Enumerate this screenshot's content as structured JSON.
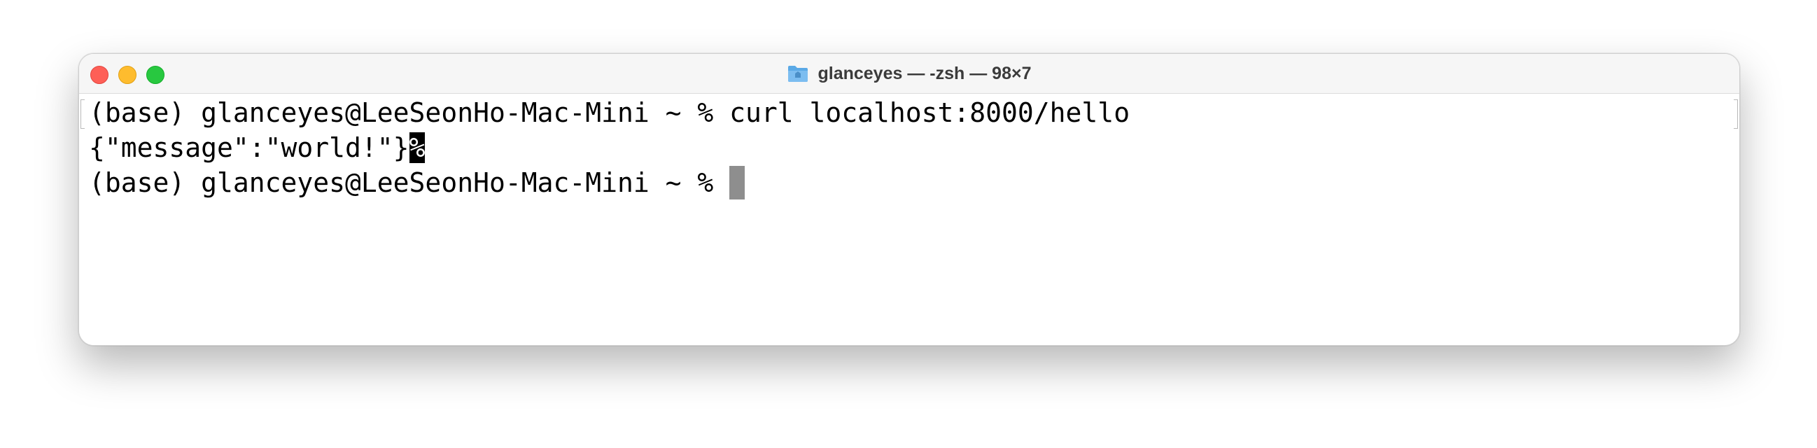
{
  "window": {
    "title": "glanceyes — -zsh — 98×7",
    "folder_icon": "folder-icon"
  },
  "terminal": {
    "line1": "(base) glanceyes@LeeSeonHo-Mac-Mini ~ % curl localhost:8000/hello",
    "line2_output": "{\"message\":\"world!\"}",
    "line2_marker": "%",
    "line3_prompt": "(base) glanceyes@LeeSeonHo-Mac-Mini ~ % "
  },
  "colors": {
    "close": "#fe5f57",
    "minimize": "#febc2e",
    "maximize": "#28c840",
    "cursor": "#8e8e8e"
  }
}
